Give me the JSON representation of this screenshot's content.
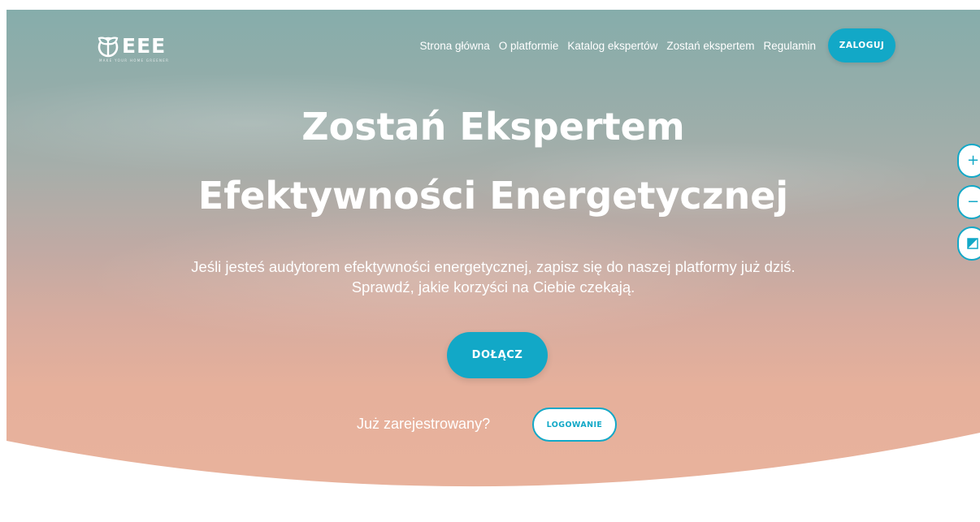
{
  "brand": {
    "name": "EEE",
    "tagline": "MAKE YOUR HOME GREENER"
  },
  "nav": {
    "items": [
      {
        "label": "Strona główna"
      },
      {
        "label": "O platformie"
      },
      {
        "label": "Katalog ekspertów"
      },
      {
        "label": "Zostań ekspertem"
      },
      {
        "label": "Regulamin"
      }
    ],
    "login_button": "ZALOGUJ"
  },
  "hero": {
    "title_line1": "Zostań Ekspertem",
    "title_line2": "Efektywności Energetycznej",
    "subtitle_line1": "Jeśli jesteś audytorem efektywności energetycznej, zapisz się do naszej platformy już dziś.",
    "subtitle_line2": "Sprawdź, jakie korzyści na Ciebie czekają.",
    "join_button": "DOŁĄCZ",
    "registered_text": "Już zarejestrowany?",
    "login_button": "LOGOWANIE"
  },
  "accessibility": {
    "zoom_in_icon": "plus-icon",
    "zoom_in_glyph": "+",
    "zoom_out_icon": "minus-icon",
    "zoom_out_glyph": "−",
    "contrast_icon": "contrast-icon"
  },
  "colors": {
    "accent": "#12a8c7",
    "sky_top": "#86adab",
    "sky_bottom": "#e9b39d",
    "background": "#ffffff"
  }
}
